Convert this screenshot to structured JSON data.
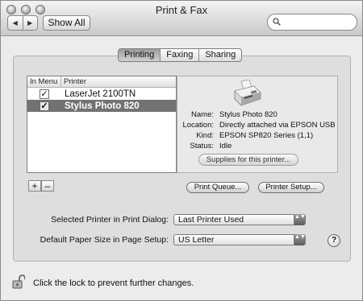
{
  "window": {
    "title": "Print & Fax"
  },
  "toolbar": {
    "back_glyph": "◀",
    "forward_glyph": "▶",
    "show_all_label": "Show All",
    "search": {
      "value": "",
      "placeholder": ""
    }
  },
  "tabs": [
    {
      "label": "Printing",
      "active": true
    },
    {
      "label": "Faxing",
      "active": false
    },
    {
      "label": "Sharing",
      "active": false
    }
  ],
  "printer_list": {
    "columns": [
      "In Menu",
      "Printer"
    ],
    "rows": [
      {
        "name": "LaserJet 2100TN",
        "in_menu": true,
        "selected": false
      },
      {
        "name": "Stylus Photo 820",
        "in_menu": true,
        "selected": true
      }
    ],
    "checkmark": "✓"
  },
  "details": {
    "labels": [
      "Name:",
      "Location:",
      "Kind:",
      "Status:"
    ],
    "values": [
      "Stylus Photo 820",
      "Directly attached via EPSON USB",
      "EPSON SP820 Series (1,1)",
      "Idle"
    ],
    "supplies_button": "Supplies for this printer..."
  },
  "list_buttons": {
    "add": "+",
    "remove": "–"
  },
  "buttons": {
    "print_queue": "Print Queue...",
    "printer_setup": "Printer Setup..."
  },
  "form": {
    "selected_printer_label": "Selected Printer in Print Dialog:",
    "selected_printer_value": "Last Printer Used",
    "paper_size_label": "Default Paper Size in Page Setup:",
    "paper_size_value": "US Letter",
    "popup_arrow": "▲▼"
  },
  "help_glyph": "?",
  "footer": {
    "lock_text": "Click the lock to prevent further changes."
  },
  "icons": {
    "search": "search-icon",
    "printer": "printer-icon",
    "lock": "lock-icon",
    "help": "help-icon"
  }
}
